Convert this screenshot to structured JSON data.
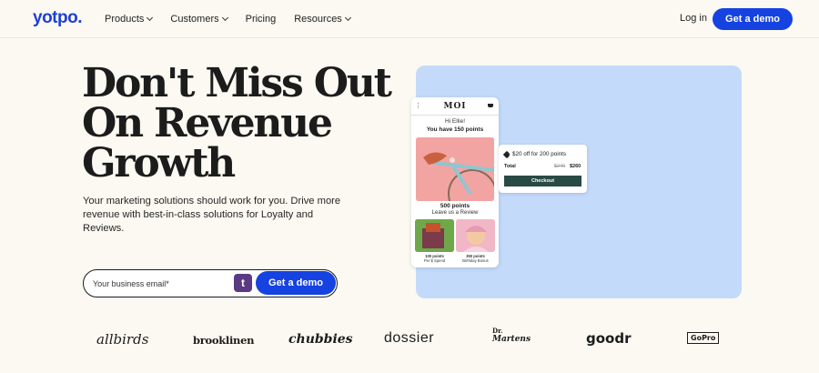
{
  "nav": {
    "logo": "yotpo.",
    "links": [
      {
        "label": "Products",
        "dropdown": true
      },
      {
        "label": "Customers",
        "dropdown": true
      },
      {
        "label": "Pricing",
        "dropdown": false
      },
      {
        "label": "Resources",
        "dropdown": true
      }
    ],
    "login": "Log in",
    "demo": "Get a demo"
  },
  "hero": {
    "headline_lines": [
      "Don't Miss Out",
      "On Revenue",
      "Growth"
    ],
    "subtext": "Your marketing solutions should work for you. Drive more revenue with best-in-class solutions for Loyalty and Reviews.",
    "email_placeholder": "Your business email*",
    "t_icon": "t",
    "demo": "Get a demo"
  },
  "mockup": {
    "brand": "MOI",
    "greeting": "Hi Ellie!",
    "points": "You have 150 points",
    "points_500": "500 points",
    "review": "Leave us a Review",
    "tile_a": [
      "100 points",
      "Per $ Spend"
    ],
    "tile_b": [
      "350 points",
      "Birthday Bonus"
    ],
    "offer": "$20 off for 200 points",
    "total_label": "Total",
    "old_price": "$240",
    "new_price": "$260",
    "checkout": "Checkout"
  },
  "logos": {
    "allbirds": "allbirds",
    "brooklinen": "brooklinen",
    "chubbies": "chubbies",
    "dossier": "dossier",
    "dr_martens_line1": "Dr.",
    "dr_martens_line2": "Martens",
    "goodr": "goodr",
    "gopro": "GoPro"
  },
  "colors": {
    "accent": "#1542e0",
    "logo": "#1d3fd6",
    "background": "#fbf9f2",
    "panel": "#c3dafb",
    "checkout": "#2a4a46"
  }
}
